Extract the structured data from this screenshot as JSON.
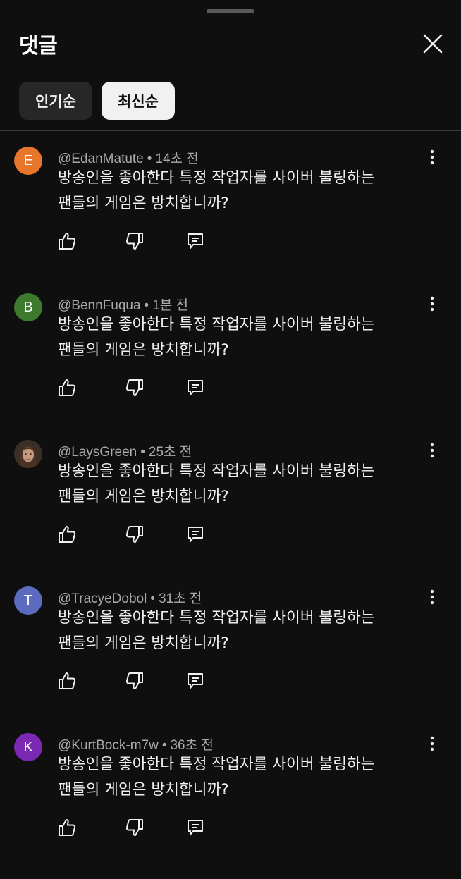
{
  "header": {
    "title": "댓글",
    "close_icon": "close-icon"
  },
  "sort_chips": [
    {
      "label": "인기순",
      "selected": false
    },
    {
      "label": "최신순",
      "selected": true
    }
  ],
  "comments": [
    {
      "avatar_letter": "E",
      "avatar_color": "#e6762b",
      "author": "@EdanMatute",
      "time": "14초 전",
      "text": "방송인을 좋아한다 특정 작업자를 사이버 불링하는\n팬들의 게임은 방치합니까?"
    },
    {
      "avatar_letter": "B",
      "avatar_color": "#3d7a2e",
      "author": "@BennFuqua",
      "time": "1분 전",
      "text": "방송인을 좋아한다 특정 작업자를 사이버 불링하는\n팬들의 게임은 방치합니까?"
    },
    {
      "avatar_letter": "",
      "avatar_color": "#5b4a3e",
      "author": "@LaysGreen",
      "time": "25초 전",
      "text": "방송인을 좋아한다 특정 작업자를 사이버 불링하는\n팬들의 게임은 방치합니까?"
    },
    {
      "avatar_letter": "T",
      "avatar_color": "#5c6bc0",
      "author": "@TracyeDobol",
      "time": "31초 전",
      "text": "방송인을 좋아한다 특정 작업자를 사이버 불링하는\n팬들의 게임은 방치합니까?"
    },
    {
      "avatar_letter": "K",
      "avatar_color": "#7b28b3",
      "author": "@KurtBock-m7w",
      "time": "36초 전",
      "text": "방송인을 좋아한다 특정 작업자를 사이버 불링하는\n팬들의 게임은 방치합니까?"
    }
  ],
  "icons": {
    "like": "thumbs-up-icon",
    "dislike": "thumbs-down-icon",
    "reply": "reply-icon",
    "more": "more-vert-icon"
  }
}
